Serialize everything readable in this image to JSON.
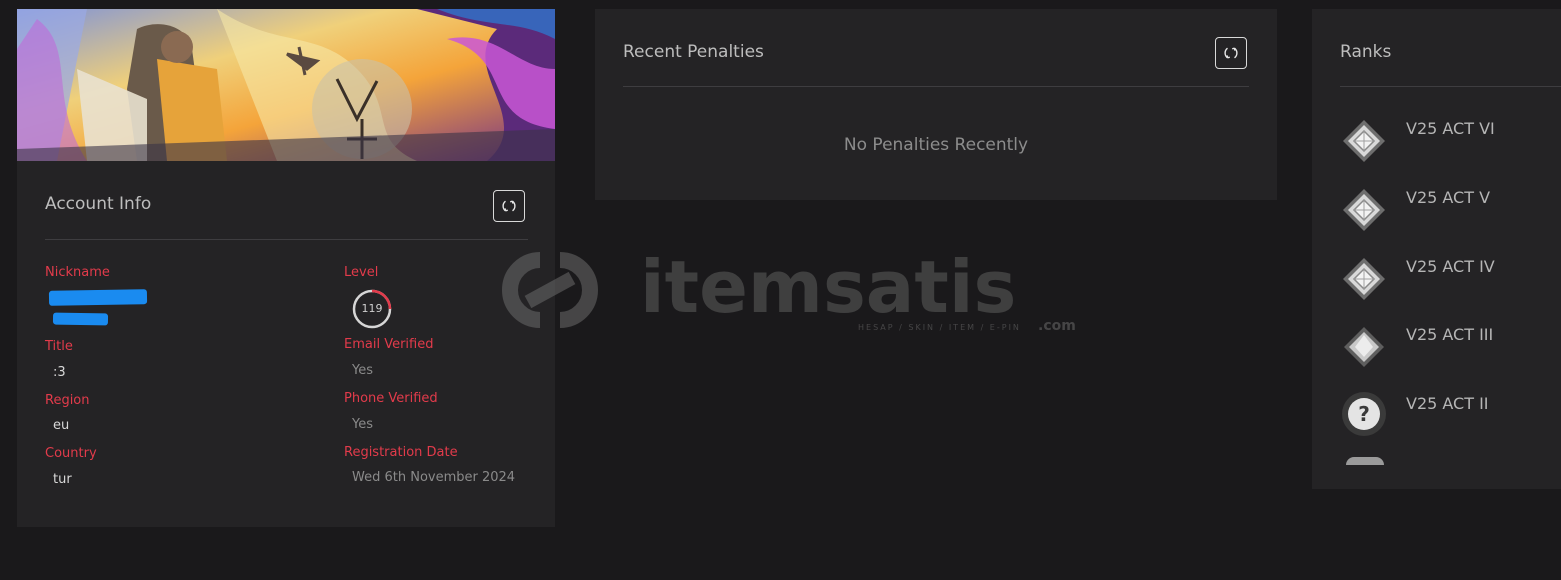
{
  "account": {
    "title": "Account Info",
    "fields": {
      "nickname_label": "Nickname",
      "level_label": "Level",
      "level_value": "119",
      "level_progress": 0.25,
      "title_label": "Title",
      "title_value": ":3",
      "email_label": "Email Verified",
      "email_value": "Yes",
      "region_label": "Region",
      "region_value": "eu",
      "phone_label": "Phone Verified",
      "phone_value": "Yes",
      "country_label": "Country",
      "country_value": "tur",
      "regdate_label": "Registration Date",
      "regdate_value": "Wed 6th November 2024"
    }
  },
  "penalties": {
    "title": "Recent Penalties",
    "empty_text": "No Penalties Recently"
  },
  "ranks": {
    "title": "Ranks",
    "items": [
      {
        "label": "V25 ACT VI",
        "icon": "silver-rank-icon"
      },
      {
        "label": "V25 ACT V",
        "icon": "silver-rank-icon"
      },
      {
        "label": "V25 ACT IV",
        "icon": "silver-rank-icon"
      },
      {
        "label": "V25 ACT III",
        "icon": "silver-rank-icon"
      },
      {
        "label": "V25 ACT II",
        "icon": "unranked-icon"
      }
    ]
  },
  "watermark": {
    "brand": "itemsatis",
    "tagline": "HESAP / SKIN / ITEM / E-PIN",
    "suffix": ".com"
  },
  "colors": {
    "background": "#1a191b",
    "card": "#242325",
    "label_red": "#e23b4b",
    "redaction_blue": "#1a8bf0"
  }
}
